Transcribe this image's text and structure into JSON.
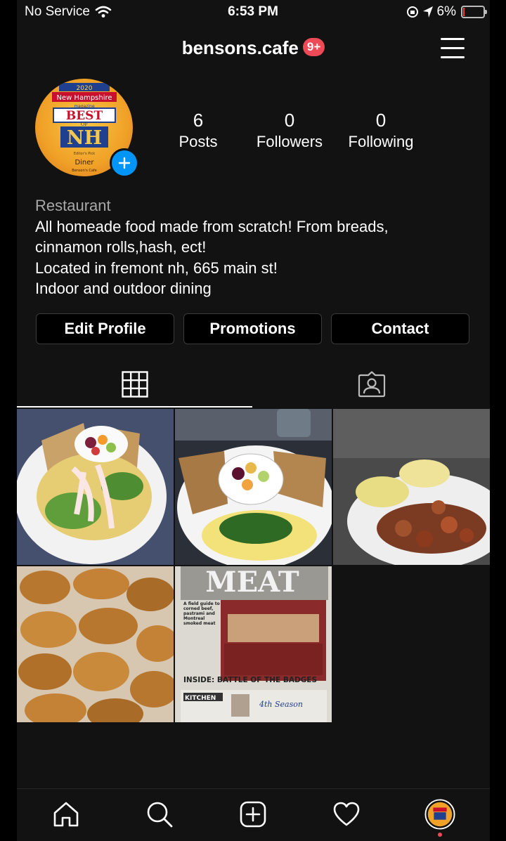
{
  "status_bar": {
    "carrier": "No Service",
    "time": "6:53 PM",
    "battery": "6%",
    "battery_level": 0.06
  },
  "header": {
    "username": "bensons.cafe",
    "notification_badge": "9+"
  },
  "profile": {
    "avatar_text": {
      "year": "2020",
      "magazine": "New Hampshire",
      "magazine_sub": "magazine",
      "best": "BEST",
      "of": "OF",
      "nh": "NH",
      "pick": "Editor's Pick",
      "category": "Diner",
      "name": "Benson's Cafe"
    },
    "stats": [
      {
        "num": "6",
        "label": "Posts"
      },
      {
        "num": "0",
        "label": "Followers"
      },
      {
        "num": "0",
        "label": "Following"
      }
    ],
    "category": "Restaurant",
    "bio_lines": [
      "All homeade food made from scratch! From breads,",
      "cinnamon rolls,hash, ect!",
      "Located in fremont nh, 665 main st!",
      "Indoor and outdoor dining"
    ]
  },
  "buttons": {
    "edit_profile": "Edit Profile",
    "promotions": "Promotions",
    "contact": "Contact"
  },
  "posts": {
    "post5_headline": "MEAT",
    "post5_blurb": "A field guide to corned beef, pastrami and Montreal smoked meat",
    "post5_inside": "INSIDE: BATTLE OF THE BADGES",
    "post5_kitchen": "KITCHEN",
    "post5_season": "4th Season"
  },
  "colors": {
    "accent_blue": "#0095f6",
    "badge_red": "#ed4956",
    "background": "#121212"
  }
}
